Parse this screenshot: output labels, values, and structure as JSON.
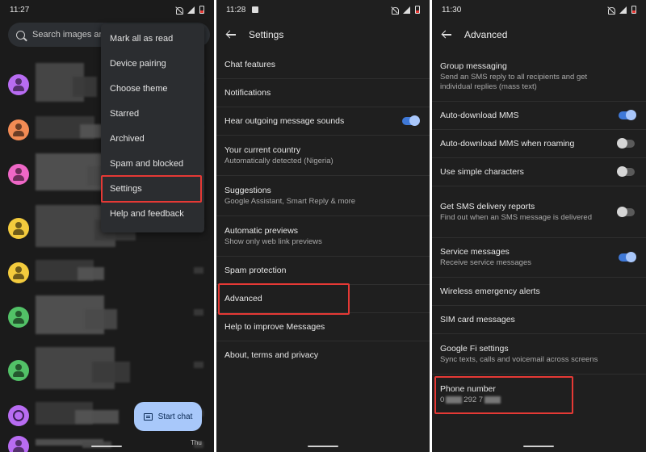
{
  "colors": {
    "highlight": "#e53935",
    "toggle_on": "#3f79d8",
    "fab": "#a8c8fa"
  },
  "panel_main": {
    "status_time": "11:27",
    "search_placeholder": "Search images an",
    "avatars": [
      {
        "color": "#b86cf2"
      },
      {
        "color": "#f28b54"
      },
      {
        "color": "#ee67c6"
      },
      {
        "color": "#f3cb3d"
      },
      {
        "color": "#f3cb3d"
      },
      {
        "color": "#52c167"
      },
      {
        "color": "#52c167"
      },
      {
        "color": "#b86cf2",
        "outline": true
      },
      {
        "color": "#b86cf2"
      }
    ],
    "menu": {
      "items": [
        "Mark all as read",
        "Device pairing",
        "Choose theme",
        "Starred",
        "Archived",
        "Spam and blocked",
        "Settings",
        "Help and feedback"
      ]
    },
    "fab_label": "Start chat",
    "day_label": "Thu"
  },
  "panel_settings": {
    "status_time": "11:28",
    "title": "Settings",
    "rows": [
      {
        "title": "Chat features",
        "subtitle": ""
      },
      {
        "title": "Notifications",
        "subtitle": ""
      },
      {
        "title": "Hear outgoing message sounds",
        "subtitle": "",
        "toggle": "on"
      },
      {
        "title": "Your current country",
        "subtitle": "Automatically detected (Nigeria)"
      },
      {
        "title": "Suggestions",
        "subtitle": "Google Assistant, Smart Reply & more"
      },
      {
        "title": "Automatic previews",
        "subtitle": "Show only web link previews"
      },
      {
        "title": "Spam protection",
        "subtitle": ""
      },
      {
        "title": "Advanced",
        "subtitle": ""
      },
      {
        "title": "Help to improve Messages",
        "subtitle": ""
      },
      {
        "title": "About, terms and privacy",
        "subtitle": ""
      }
    ]
  },
  "panel_advanced": {
    "status_time": "11:30",
    "title": "Advanced",
    "rows": [
      {
        "title": "Group messaging",
        "subtitle": "Send an SMS reply to all recipients and get individual replies (mass text)"
      },
      {
        "title": "Auto-download MMS",
        "subtitle": "",
        "toggle": "on"
      },
      {
        "title": "Auto-download MMS when roaming",
        "subtitle": "",
        "toggle": "off"
      },
      {
        "title": "Use simple characters",
        "subtitle": "",
        "toggle": "off"
      },
      {
        "title": "Get SMS delivery reports",
        "subtitle": "Find out when an SMS message is delivered",
        "toggle": "off"
      },
      {
        "title": "Service messages",
        "subtitle": "Receive service messages",
        "toggle": "on"
      },
      {
        "title": "Wireless emergency alerts",
        "subtitle": ""
      },
      {
        "title": "SIM card messages",
        "subtitle": ""
      },
      {
        "title": "Google Fi settings",
        "subtitle": "Sync texts, calls and voicemail across screens"
      },
      {
        "title": "Phone number",
        "subtitle_prefix": "0",
        "subtitle_mid": "292 7"
      }
    ]
  }
}
